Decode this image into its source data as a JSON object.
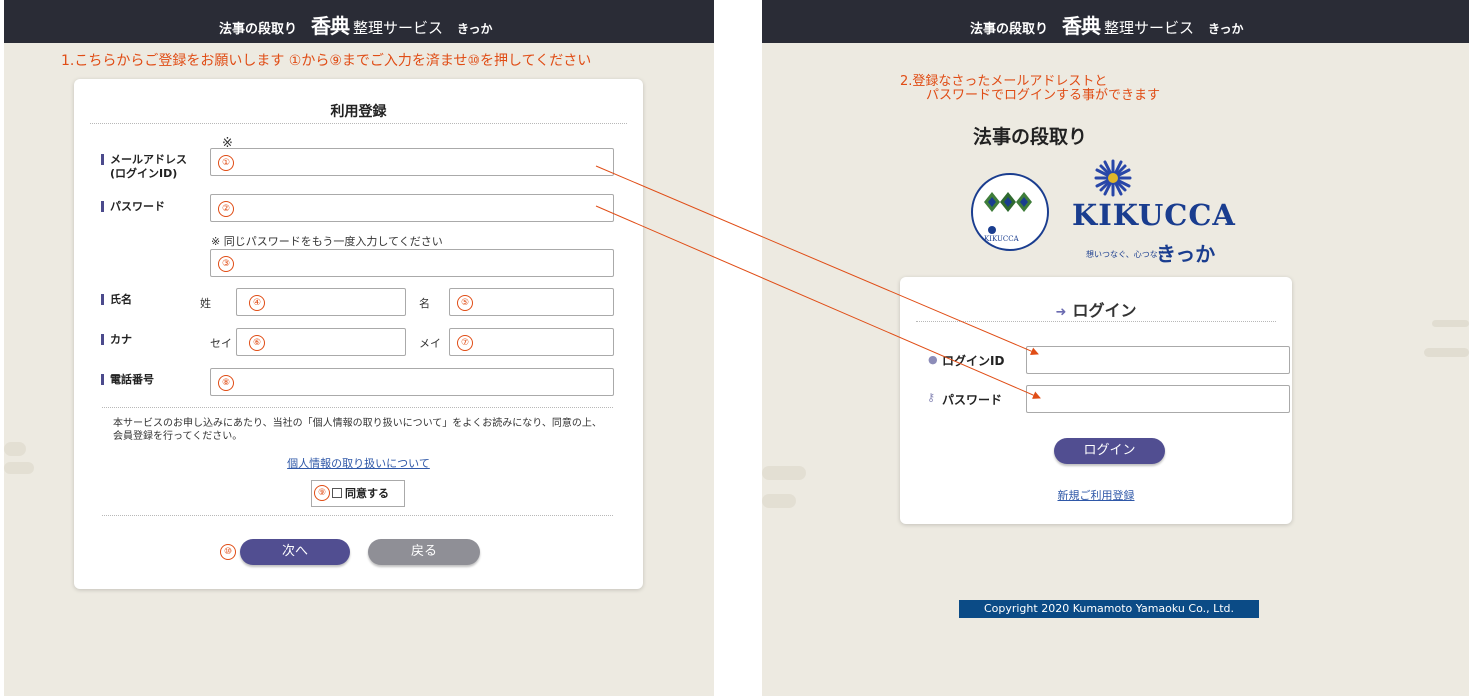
{
  "header": {
    "main": "法事の段取り",
    "koden": "香典",
    "sub": "整理サービス",
    "kicca": "きっか"
  },
  "left": {
    "instruction": "1.こちらからご登録をお願いします ①から⑨までご入力を済ませ⑩を押してください",
    "form_title": "利用登録",
    "asterisk": "※",
    "email_label": "メールアドレス",
    "email_label2": "(ログインID)",
    "password_label": "パスワード",
    "password_note": "※ 同じパスワードをもう一度入力してください",
    "name_label": "氏名",
    "sei_label": "姓",
    "mei_label": "名",
    "kana_label": "カナ",
    "sei_kana_label": "セイ",
    "mei_kana_label": "メイ",
    "phone_label": "電話番号",
    "markers": [
      "①",
      "②",
      "③",
      "④",
      "⑤",
      "⑥",
      "⑦",
      "⑧",
      "⑨",
      "⑩"
    ],
    "privacy_text": "本サービスのお申し込みにあたり、当社の「個人情報の取り扱いについて」をよくお読みになり、同意の上、会員登録を行ってください。",
    "privacy_link": "個人情報の取り扱いについて",
    "agree_label": "同意する",
    "next_button": "次へ",
    "back_button": "戻る"
  },
  "right": {
    "instruction_line1": "2.登録なさったメールアドレストと",
    "instruction_line2": "パスワードでログインする事ができます",
    "title": "法事の段取り",
    "logo_text": "KIKUCCA",
    "logo_small": "KIKUCCA",
    "tagline": "想いつなぐ、心つなぐ",
    "logo_kicca": "きっか",
    "login_title": "ログイン",
    "login_id_label": "ログインID",
    "password_label": "パスワード",
    "login_button": "ログイン",
    "register_link": "新規ご利用登録",
    "copyright": "Copyright 2020 Kumamoto Yamaoku Co., Ltd."
  },
  "colors": {
    "header_bg": "#2a2c36",
    "page_bg": "#edeae1",
    "accent": "#514e91",
    "annotation": "#e04d16",
    "copyright_bg": "#0b4b86",
    "logo_blue": "#1a3d8f",
    "logo_green": "#3f7d3a"
  },
  "icons": [
    "signin-icon",
    "user-icon",
    "key-icon",
    "checkbox-icon",
    "flower-icon"
  ]
}
